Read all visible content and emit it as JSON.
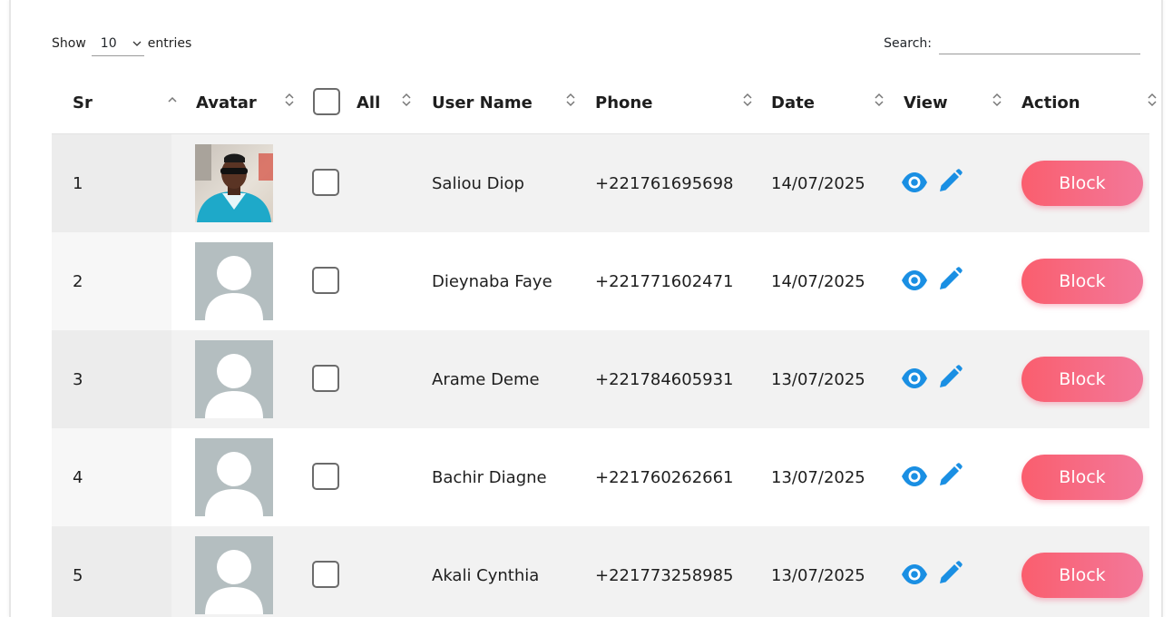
{
  "length_menu": {
    "show_label": "Show",
    "selected": "10",
    "entries_label": "entries"
  },
  "search": {
    "label": "Search:",
    "value": "",
    "placeholder": ""
  },
  "columns": {
    "sr": "Sr",
    "avatar": "Avatar",
    "all": "All",
    "user_name": "User Name",
    "phone": "Phone",
    "date": "Date",
    "view": "View",
    "action": "Action"
  },
  "sort_state": {
    "sr": "ascending"
  },
  "rows": [
    {
      "sr": "1",
      "avatar": "photo",
      "user_name": "Saliou Diop",
      "phone": "+221761695698",
      "date": "14/07/2025",
      "action": "Block"
    },
    {
      "sr": "2",
      "avatar": "default-avatar",
      "user_name": "Dieynaba Faye",
      "phone": "+221771602471",
      "date": "14/07/2025",
      "action": "Block"
    },
    {
      "sr": "3",
      "avatar": "default-avatar",
      "user_name": "Arame Deme",
      "phone": "+221784605931",
      "date": "13/07/2025",
      "action": "Block"
    },
    {
      "sr": "4",
      "avatar": "default-avatar",
      "user_name": "Bachir Diagne",
      "phone": "+221760262661",
      "date": "13/07/2025",
      "action": "Block"
    },
    {
      "sr": "5",
      "avatar": "default-avatar",
      "user_name": "Akali Cynthia",
      "phone": "+221773258985",
      "date": "13/07/2025",
      "action": "Block"
    }
  ],
  "icons": {
    "view": "eye-icon",
    "edit": "pencil-icon",
    "sort": "sort-arrows-icon"
  },
  "colors": {
    "action_icon": "#1a8fe3",
    "block_button_start": "#fa5e6e",
    "block_button_end": "#f3789a",
    "default_avatar_bg": "#b4bec0"
  }
}
